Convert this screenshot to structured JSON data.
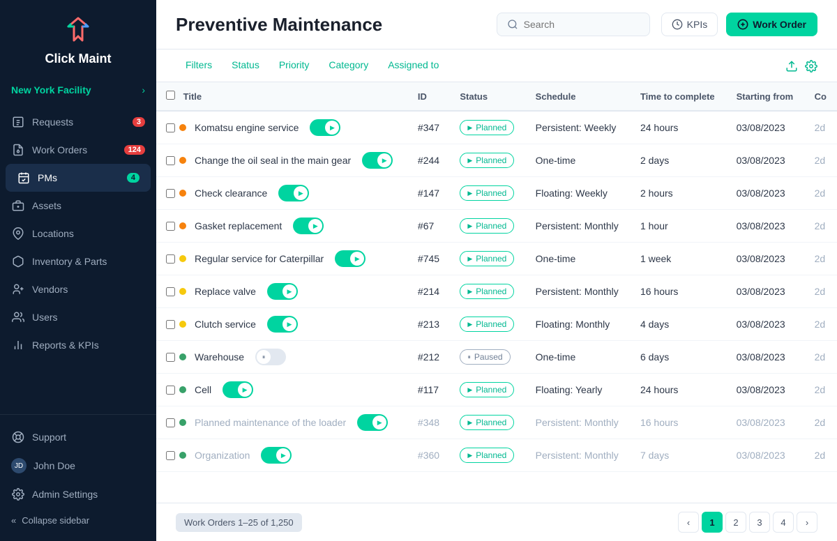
{
  "sidebar": {
    "logo_text": "Click Maint",
    "facility": "New York Facility",
    "nav_items": [
      {
        "id": "requests",
        "label": "Requests",
        "badge": "3",
        "badge_type": "red"
      },
      {
        "id": "work-orders",
        "label": "Work Orders",
        "badge": "124",
        "badge_type": "red"
      },
      {
        "id": "pms",
        "label": "PMs",
        "badge": "4",
        "badge_type": "teal",
        "active": true
      },
      {
        "id": "assets",
        "label": "Assets"
      },
      {
        "id": "locations",
        "label": "Locations"
      },
      {
        "id": "inventory-parts",
        "label": "Inventory & Parts"
      },
      {
        "id": "vendors",
        "label": "Vendors"
      },
      {
        "id": "users",
        "label": "Users"
      },
      {
        "id": "reports-kpis",
        "label": "Reports & KPIs"
      }
    ],
    "support_label": "Support",
    "user_name": "John Doe",
    "admin_settings_label": "Admin Settings",
    "collapse_label": "Collapse sidebar"
  },
  "header": {
    "title": "Preventive Maintenance",
    "search_placeholder": "Search",
    "kpi_label": "KPIs",
    "work_order_label": "Work Order"
  },
  "filter_bar": {
    "tabs": [
      "Filters",
      "Status",
      "Priority",
      "Category",
      "Assigned to"
    ]
  },
  "table": {
    "columns": [
      "Title",
      "ID",
      "Status",
      "Schedule",
      "Time to complete",
      "Starting from",
      "Co"
    ],
    "rows": [
      {
        "title": "Komatsu engine service",
        "priority": "orange",
        "toggle": "on",
        "id": "#347",
        "status": "Planned",
        "schedule": "Persistent: Weekly",
        "time": "24 hours",
        "starting": "03/08/2023",
        "co": "2d",
        "faded": false
      },
      {
        "title": "Change the oil seal in the main gear",
        "priority": "orange",
        "toggle": "on",
        "id": "#244",
        "status": "Planned",
        "schedule": "One-time",
        "time": "2 days",
        "starting": "03/08/2023",
        "co": "2d",
        "faded": false
      },
      {
        "title": "Check clearance",
        "priority": "orange",
        "toggle": "on",
        "id": "#147",
        "status": "Planned",
        "schedule": "Floating: Weekly",
        "time": "2 hours",
        "starting": "03/08/2023",
        "co": "2d",
        "faded": false
      },
      {
        "title": "Gasket replacement",
        "priority": "orange",
        "toggle": "on",
        "id": "#67",
        "status": "Planned",
        "schedule": "Persistent: Monthly",
        "time": "1 hour",
        "starting": "03/08/2023",
        "co": "2d",
        "faded": false
      },
      {
        "title": "Regular service for Caterpillar",
        "priority": "yellow",
        "toggle": "on",
        "id": "#745",
        "status": "Planned",
        "schedule": "One-time",
        "time": "1 week",
        "starting": "03/08/2023",
        "co": "2d",
        "faded": false
      },
      {
        "title": "Replace valve",
        "priority": "yellow",
        "toggle": "on",
        "id": "#214",
        "status": "Planned",
        "schedule": "Persistent: Monthly",
        "time": "16 hours",
        "starting": "03/08/2023",
        "co": "2d",
        "faded": false
      },
      {
        "title": "Clutch service",
        "priority": "yellow",
        "toggle": "on",
        "id": "#213",
        "status": "Planned",
        "schedule": "Floating: Monthly",
        "time": "4 days",
        "starting": "03/08/2023",
        "co": "2d",
        "faded": false
      },
      {
        "title": "Warehouse",
        "priority": "green",
        "toggle": "paused",
        "id": "#212",
        "status": "Paused",
        "schedule": "One-time",
        "time": "6 days",
        "starting": "03/08/2023",
        "co": "2d",
        "faded": false
      },
      {
        "title": "Cell",
        "priority": "green",
        "toggle": "on",
        "id": "#117",
        "status": "Planned",
        "schedule": "Floating: Yearly",
        "time": "24 hours",
        "starting": "03/08/2023",
        "co": "2d",
        "faded": false
      },
      {
        "title": "Planned maintenance of the loader",
        "priority": "green",
        "toggle": "on",
        "id": "#348",
        "status": "Planned",
        "schedule": "Persistent: Monthly",
        "time": "16 hours",
        "starting": "03/08/2023",
        "co": "2d",
        "faded": true
      },
      {
        "title": "Organization",
        "priority": "green",
        "toggle": "on",
        "id": "#360",
        "status": "Planned",
        "schedule": "Persistent: Monthly",
        "time": "7 days",
        "starting": "03/08/2023",
        "co": "2d",
        "faded": true
      }
    ]
  },
  "footer": {
    "work_orders_label": "Work Orders",
    "range": "1–25",
    "total": "1,250",
    "pages": [
      "1",
      "2",
      "3",
      "4"
    ]
  },
  "colors": {
    "teal": "#00d4a0",
    "sidebar_bg": "#0d1b2e",
    "active_bg": "#1a2e4a"
  }
}
